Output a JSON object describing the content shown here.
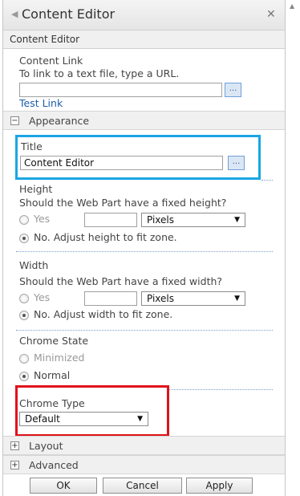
{
  "header": {
    "title": "Content Editor",
    "collapse_icon": "triangle-left-icon",
    "close_icon": "close-icon",
    "close_glyph": "✕"
  },
  "subheader": "Content Editor",
  "content_link": {
    "label": "Content Link",
    "hint": "To link to a text file, type a URL.",
    "value": "",
    "browse_label": "...",
    "test_link": "Test Link"
  },
  "appearance": {
    "section_title": "Appearance",
    "expander_symbol": "−",
    "title_field": {
      "label": "Title",
      "value": "Content Editor",
      "browse_label": "..."
    },
    "height": {
      "label": "Height",
      "question": "Should the Web Part have a fixed height?",
      "yes_label": "Yes",
      "value": "",
      "unit": "Pixels",
      "no_label": "No. Adjust height to fit zone."
    },
    "width": {
      "label": "Width",
      "question": "Should the Web Part have a fixed width?",
      "yes_label": "Yes",
      "value": "",
      "unit": "Pixels",
      "no_label": "No. Adjust width to fit zone."
    },
    "chrome_state": {
      "label": "Chrome State",
      "minimized": "Minimized",
      "normal": "Normal"
    },
    "chrome_type": {
      "label": "Chrome Type",
      "value": "Default"
    }
  },
  "sections": [
    {
      "title": "Layout",
      "expander_symbol": "+"
    },
    {
      "title": "Advanced",
      "expander_symbol": "+"
    }
  ],
  "buttons": {
    "ok": "OK",
    "cancel": "Cancel",
    "apply": "Apply"
  },
  "colors": {
    "highlight_title": "#1aa6e3",
    "highlight_chrome_type": "#e0121b",
    "link": "#1d5ea8"
  }
}
